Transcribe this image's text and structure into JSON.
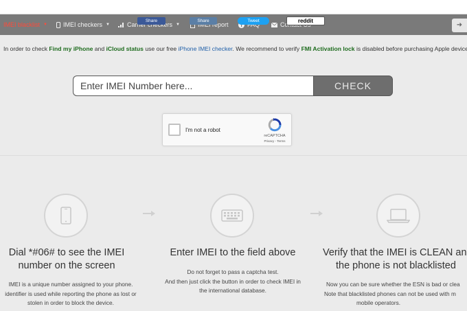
{
  "nav": {
    "items": [
      {
        "label": "IMEI blacklist",
        "icon": "none",
        "active": true
      },
      {
        "label": "IMEI checkers",
        "icon": "phone-icon",
        "active": false
      },
      {
        "label": "Carrier checkers",
        "icon": "signal-icon",
        "active": false
      },
      {
        "label": "IMEI report",
        "icon": "document-icon",
        "active": false
      },
      {
        "label": "FAQ",
        "icon": "info-icon",
        "active": false
      },
      {
        "label": "Contact Us",
        "icon": "envelope-icon",
        "active": false
      }
    ],
    "active_color": "#ff4b3a"
  },
  "share": {
    "facebook": "Share",
    "vk": "Share",
    "twitter": "Tweet",
    "reddit": "reddit"
  },
  "info": {
    "t1": "In order to check ",
    "find_my_iphone": "Find my iPhone",
    "t2": " and ",
    "icloud_status": "iCloud status",
    "t3": " use our free ",
    "checker_link": "iPhone IMEI checker",
    "t4": ". We recommend to verify ",
    "fmi": "FMI Activation lock",
    "t5": " is disabled before purchasing Apple device"
  },
  "form": {
    "placeholder": "Enter IMEI Number here...",
    "check_label": "CHECK"
  },
  "captcha": {
    "label": "I'm not a robot",
    "brand": "reCAPTCHA",
    "terms": "Privacy - Terms"
  },
  "steps": [
    {
      "icon": "mobile-phone-icon",
      "title_lines": [
        "Dial *#06# to see the IMEI",
        "number on the screen"
      ],
      "desc_lines": [
        "IMEI is a unique number assigned to your phone.",
        "identifier is used while reporting the phone as lost or",
        "stolen in order to block the device."
      ]
    },
    {
      "icon": "keyboard-icon",
      "title_lines": [
        "Enter IMEI to the field above"
      ],
      "desc_lines": [
        "Do not forget to pass a captcha test.",
        "And then just click the button in order to check IMEI in",
        "the international database."
      ]
    },
    {
      "icon": "laptop-icon",
      "title_lines": [
        "Verify that the IMEI is CLEAN an",
        "the phone is not blacklisted"
      ],
      "desc_lines": [
        "Now you can be sure whether the ESN is bad or clea",
        "Note that blacklisted phones can not be used with m",
        "mobile operators."
      ]
    }
  ]
}
